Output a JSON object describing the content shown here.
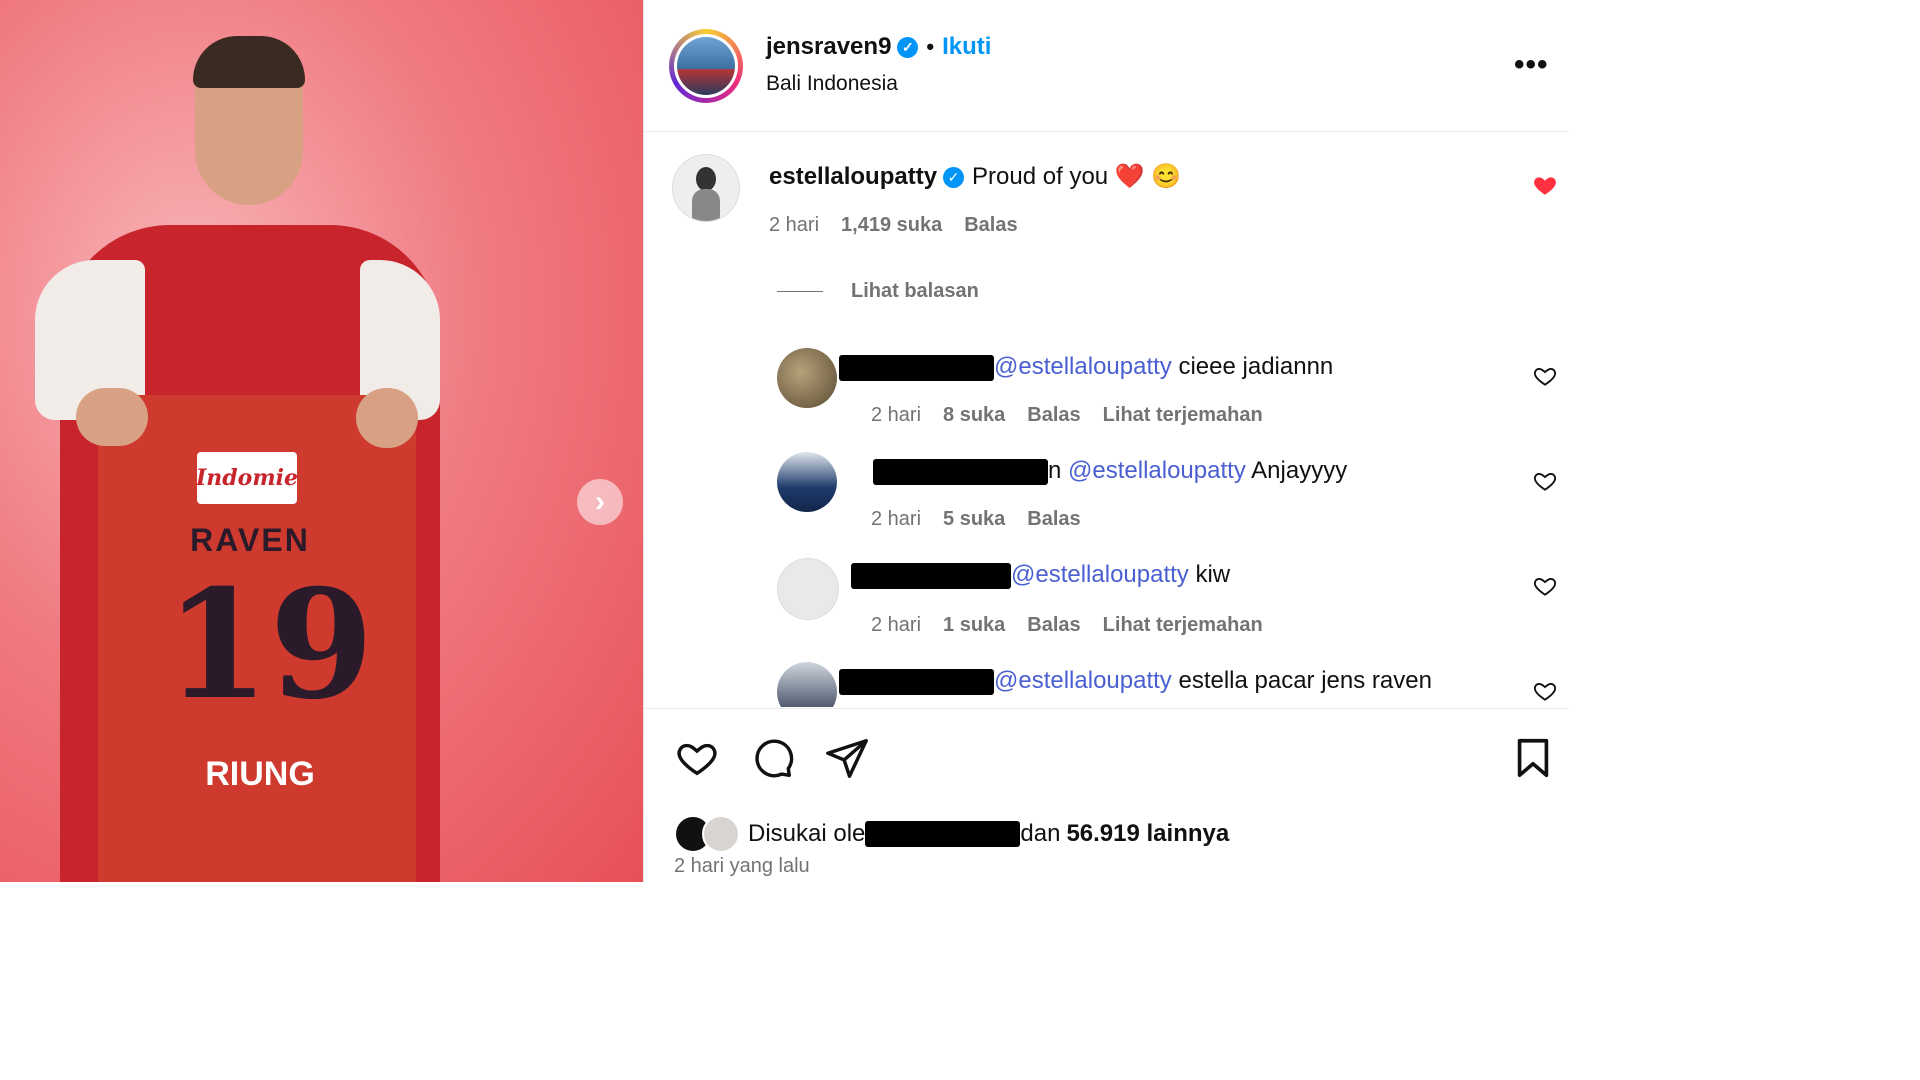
{
  "post": {
    "username": "jensraven9",
    "follow_label": "Ikuti",
    "location": "Bali Indonesia",
    "more_label": "•••",
    "next_arrow": "›",
    "jersey": {
      "sponsor": "Indomie",
      "name": "RAVEN",
      "number": "19",
      "sponsor2": "RIUNG"
    }
  },
  "main_comment": {
    "username": "estellaloupatty",
    "text": "Proud of you ❤️ 😊",
    "time": "2 hari",
    "likes": "1,419 suka",
    "reply": "Balas",
    "view_replies": "Lihat balasan"
  },
  "replies": [
    {
      "mention": "@estellaloupatty",
      "text": "cieee jadiannn",
      "time": "2 hari",
      "likes": "8 suka",
      "reply": "Balas",
      "translate": "Lihat terjemahan"
    },
    {
      "mention": "@estellaloupatty",
      "text": "Anjayyyy",
      "time": "2 hari",
      "likes": "5 suka",
      "reply": "Balas",
      "translate": ""
    },
    {
      "mention": "@estellaloupatty",
      "text": "kiw",
      "time": "2 hari",
      "likes": "1 suka",
      "reply": "Balas",
      "translate": "Lihat terjemahan"
    },
    {
      "mention": "@estellaloupatty",
      "text": "estella pacar jens raven",
      "time": "",
      "likes": "",
      "reply": "",
      "translate": ""
    }
  ],
  "footer": {
    "liked_prefix": "Disukai ole",
    "liked_suffix": "dan",
    "liked_count": "56.919 lainnya",
    "time_ago": "2 hari yang lalu"
  },
  "colors": {
    "accent": "#0095f6",
    "mention": "#4a5fd1",
    "like_red": "#ff3040",
    "muted": "#737373"
  }
}
